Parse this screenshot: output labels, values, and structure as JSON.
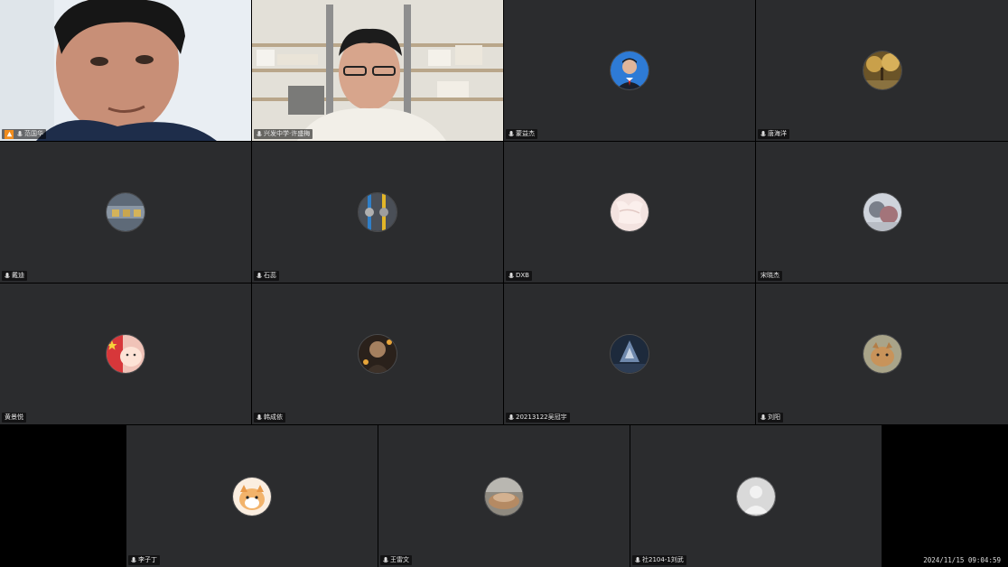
{
  "meeting": {
    "timestamp": "2024/11/15 09:04:59"
  },
  "participants": [
    {
      "name": "范国华",
      "video": true,
      "host": true
    },
    {
      "name": "兴发中学·许盛梅",
      "video": true,
      "active": true
    },
    {
      "name": "蒙益杰"
    },
    {
      "name": "唐海洋"
    },
    {
      "name": "戴迪"
    },
    {
      "name": "石蕊"
    },
    {
      "name": "DXB"
    },
    {
      "name": "宋晓杰"
    },
    {
      "name": "黄景悦"
    },
    {
      "name": "韩成依"
    },
    {
      "name": "20213122吴冠宇"
    },
    {
      "name": "刘阳"
    },
    {
      "name": "李子丁"
    },
    {
      "name": "王雷文"
    },
    {
      "name": "社2104-1刘武"
    }
  ]
}
